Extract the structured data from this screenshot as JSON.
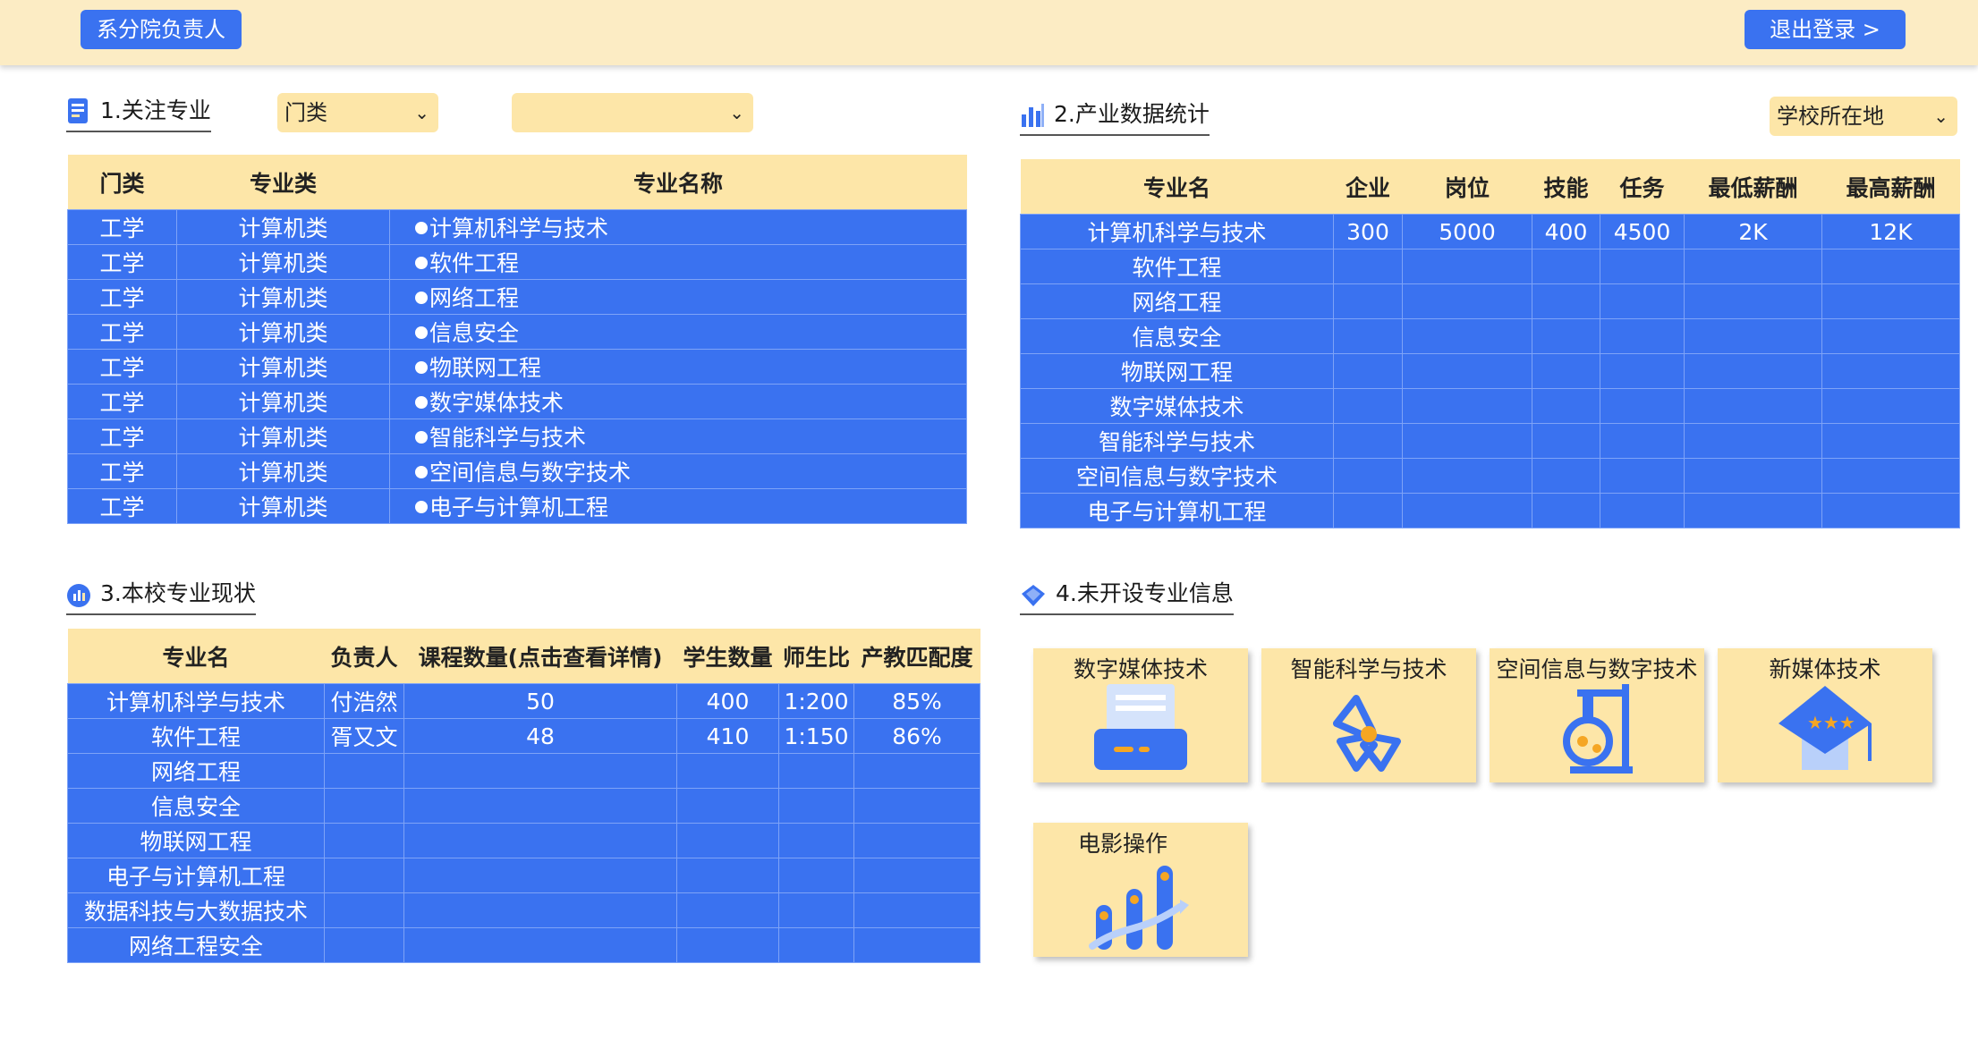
{
  "header": {
    "role_label": "系分院负责人",
    "logout_label": "退出登录 >"
  },
  "focus": {
    "title": "1.关注专业",
    "select_category": "门类",
    "select_sub": "",
    "columns": [
      "门类",
      "专业类",
      "专业名称"
    ],
    "rows": [
      [
        "工学",
        "计算机类",
        "计算机科学与技术"
      ],
      [
        "工学",
        "计算机类",
        "软件工程"
      ],
      [
        "工学",
        "计算机类",
        "网络工程"
      ],
      [
        "工学",
        "计算机类",
        "信息安全"
      ],
      [
        "工学",
        "计算机类",
        "物联网工程"
      ],
      [
        "工学",
        "计算机类",
        "数字媒体技术"
      ],
      [
        "工学",
        "计算机类",
        "智能科学与技术"
      ],
      [
        "工学",
        "计算机类",
        "空间信息与数字技术"
      ],
      [
        "工学",
        "计算机类",
        "电子与计算机工程"
      ]
    ]
  },
  "industry": {
    "title": "2.产业数据统计",
    "select_location": "学校所在地",
    "columns": [
      "专业名",
      "企业",
      "岗位",
      "技能",
      "任务",
      "最低薪酬",
      "最高薪酬"
    ],
    "rows": [
      [
        "计算机科学与技术",
        "300",
        "5000",
        "400",
        "4500",
        "2K",
        "12K"
      ],
      [
        "软件工程",
        "",
        "",
        "",
        "",
        "",
        ""
      ],
      [
        "网络工程",
        "",
        "",
        "",
        "",
        "",
        ""
      ],
      [
        "信息安全",
        "",
        "",
        "",
        "",
        "",
        ""
      ],
      [
        "物联网工程",
        "",
        "",
        "",
        "",
        "",
        ""
      ],
      [
        "数字媒体技术",
        "",
        "",
        "",
        "",
        "",
        ""
      ],
      [
        "智能科学与技术",
        "",
        "",
        "",
        "",
        "",
        ""
      ],
      [
        "空间信息与数字技术",
        "",
        "",
        "",
        "",
        "",
        ""
      ],
      [
        "电子与计算机工程",
        "",
        "",
        "",
        "",
        "",
        ""
      ]
    ]
  },
  "status": {
    "title": "3.本校专业现状",
    "columns": [
      "专业名",
      "负责人",
      "课程数量(点击查看详情)",
      "学生数量",
      "师生比",
      "产教匹配度"
    ],
    "rows": [
      [
        "计算机科学与技术",
        "付浩然",
        "50",
        "400",
        "1:200",
        "85%"
      ],
      [
        "软件工程",
        "胥又文",
        "48",
        "410",
        "1:150",
        "86%"
      ],
      [
        "网络工程",
        "",
        "",
        "",
        "",
        ""
      ],
      [
        "信息安全",
        "",
        "",
        "",
        "",
        ""
      ],
      [
        "物联网工程",
        "",
        "",
        "",
        "",
        ""
      ],
      [
        "电子与计算机工程",
        "",
        "",
        "",
        "",
        ""
      ],
      [
        "数据科技与大数据技术",
        "",
        "",
        "",
        "",
        ""
      ],
      [
        "网络工程安全",
        "",
        "",
        "",
        "",
        ""
      ]
    ]
  },
  "unopened": {
    "title": "4.未开设专业信息",
    "cards": [
      {
        "label": "数字媒体技术",
        "icon": "printer-icon"
      },
      {
        "label": "智能科学与技术",
        "icon": "radiation-icon"
      },
      {
        "label": "空间信息与数字技术",
        "icon": "flask-icon"
      },
      {
        "label": "新媒体技术",
        "icon": "graduation-cap-icon"
      },
      {
        "label": "电影操作",
        "icon": "bar-growth-icon"
      }
    ]
  },
  "colors": {
    "accent": "#3a72f0",
    "header_bg": "#fcecc4",
    "cream": "#fde6a8"
  }
}
